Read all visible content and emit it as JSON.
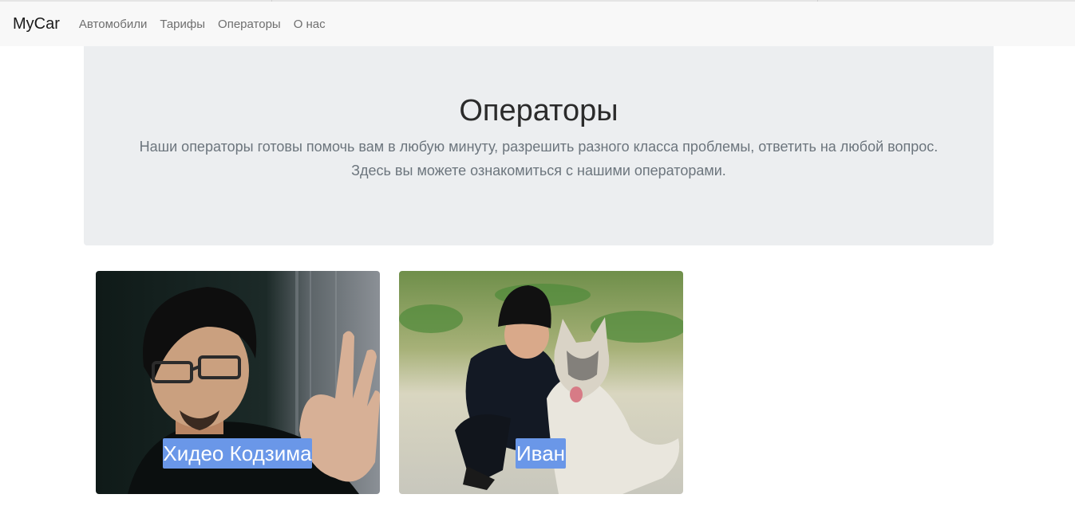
{
  "navbar": {
    "brand": "MyCar",
    "links": [
      "Автомобили",
      "Тарифы",
      "Операторы",
      "О нас"
    ]
  },
  "hero": {
    "title": "Операторы",
    "lead_line1": "Наши операторы готовы помочь вам в любую минуту, разрешить разного класса проблемы, ответить на любой вопрос.",
    "lead_line2": "Здесь вы можете ознакомиться с нашими операторами."
  },
  "operators": [
    {
      "name": "Хидео Кодзима",
      "photo_icon": "person-photo"
    },
    {
      "name": "Иван",
      "photo_icon": "person-with-dog-photo"
    }
  ],
  "colors": {
    "navbar_bg": "#f8f8f8",
    "jumbotron_bg": "#eceef0",
    "caption_bg": "#6a97e8"
  }
}
